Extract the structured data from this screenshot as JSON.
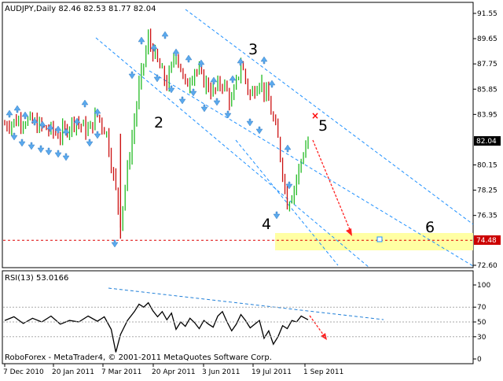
{
  "colors": {
    "bull": "#22bb22",
    "bear": "#cc1111",
    "channel": "#1e90ff",
    "fractal": "#5aa9ee",
    "rsi_line": "#000000",
    "trend": "#1f7fd8",
    "arrow": "#ff2020",
    "target_band": "#ffff99",
    "support": "#dd0000",
    "cross": "#ff0000",
    "price_tag_bg": "#000000",
    "support_tag_bg": "#cc0000"
  },
  "main_chart": {
    "header": "AUDJPY,Daily  82.46 82.53 81.77 82.04",
    "current_price_label": "82.04",
    "support_label": "74.48",
    "support_level": 74.48,
    "ticks": [
      "91.55",
      "89.65",
      "87.75",
      "85.85",
      "83.95",
      "82.04",
      "80.15",
      "78.25",
      "76.35",
      "74.48",
      "72.60"
    ],
    "wave_labels": {
      "w2": "2",
      "w3": "3",
      "w4": "4",
      "w5": "5",
      "w6": "6"
    }
  },
  "rsi_panel": {
    "header": "RSI(13) 53.0166",
    "ticks": [
      "100",
      "70",
      "50",
      "30",
      "0"
    ]
  },
  "x_axis": {
    "labels": [
      "7 Dec 2010",
      "20 Jan 2011",
      "7 Mar 2011",
      "20 Apr 2011",
      "3 Jun 2011",
      "19 Jul 2011",
      "1 Sep 2011"
    ]
  },
  "footer": "RoboForex - MetaTrader4, © 2001-2011 MetaQuotes Software Corp.",
  "chart_data": {
    "type": "ohlc",
    "symbol": "AUDJPY",
    "timeframe": "Daily",
    "ylim": [
      72.6,
      91.55
    ],
    "close_path": [
      [
        0,
        83.2
      ],
      [
        8,
        83.6
      ],
      [
        16,
        83.0
      ],
      [
        24,
        82.4
      ],
      [
        30,
        83.5
      ],
      [
        36,
        82.7
      ],
      [
        40,
        83.9
      ],
      [
        44,
        82.5
      ],
      [
        50,
        76.0
      ],
      [
        54,
        81.0
      ],
      [
        58,
        86.0
      ],
      [
        62,
        89.6
      ],
      [
        66,
        87.8
      ],
      [
        70,
        86.2
      ],
      [
        74,
        88.7
      ],
      [
        78,
        86.0
      ],
      [
        82,
        87.4
      ],
      [
        86,
        86.5
      ],
      [
        90,
        85.6
      ],
      [
        94,
        86.4
      ],
      [
        98,
        84.8
      ],
      [
        102,
        87.8
      ],
      [
        106,
        85.3
      ],
      [
        110,
        86.6
      ],
      [
        114,
        84.9
      ],
      [
        118,
        82.0
      ],
      [
        122,
        77.3
      ],
      [
        125,
        78.5
      ],
      [
        128,
        80.5
      ],
      [
        131,
        82.04
      ]
    ],
    "rsi": {
      "name": "RSI(13)",
      "last": 53.0166,
      "ylim": [
        0,
        100
      ],
      "levels": [
        30,
        50,
        70
      ],
      "values": [
        [
          0,
          52
        ],
        [
          4,
          57
        ],
        [
          8,
          48
        ],
        [
          12,
          55
        ],
        [
          16,
          50
        ],
        [
          20,
          58
        ],
        [
          24,
          47
        ],
        [
          28,
          52
        ],
        [
          32,
          50
        ],
        [
          36,
          58
        ],
        [
          40,
          51
        ],
        [
          43,
          57
        ],
        [
          46,
          40
        ],
        [
          48,
          9
        ],
        [
          50,
          33
        ],
        [
          53,
          52
        ],
        [
          56,
          64
        ],
        [
          58,
          74
        ],
        [
          60,
          70
        ],
        [
          62,
          76
        ],
        [
          64,
          65
        ],
        [
          66,
          57
        ],
        [
          68,
          64
        ],
        [
          70,
          53
        ],
        [
          72,
          62
        ],
        [
          74,
          40
        ],
        [
          76,
          50
        ],
        [
          78,
          44
        ],
        [
          80,
          55
        ],
        [
          82,
          49
        ],
        [
          84,
          41
        ],
        [
          86,
          52
        ],
        [
          88,
          47
        ],
        [
          90,
          43
        ],
        [
          92,
          58
        ],
        [
          94,
          64
        ],
        [
          96,
          50
        ],
        [
          98,
          38
        ],
        [
          100,
          47
        ],
        [
          102,
          60
        ],
        [
          104,
          52
        ],
        [
          106,
          42
        ],
        [
          108,
          47
        ],
        [
          110,
          52
        ],
        [
          112,
          28
        ],
        [
          114,
          38
        ],
        [
          116,
          20
        ],
        [
          118,
          30
        ],
        [
          120,
          45
        ],
        [
          122,
          41
        ],
        [
          124,
          52
        ],
        [
          126,
          50
        ],
        [
          128,
          58
        ],
        [
          131,
          53
        ]
      ]
    }
  }
}
